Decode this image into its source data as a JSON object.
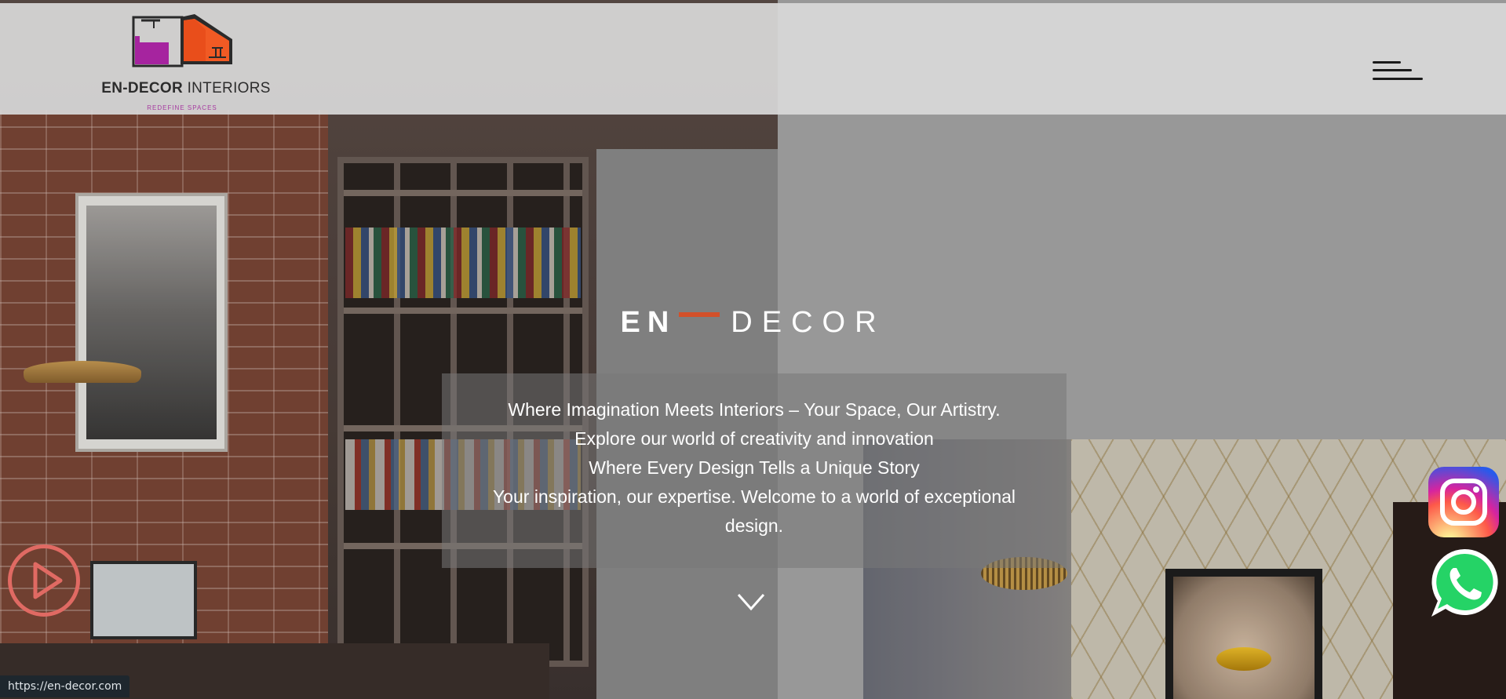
{
  "header": {
    "logo_name_bold": "EN-DECOR",
    "logo_name_rest": " INTERIORS",
    "logo_tagline": "REDEFINE SPACES",
    "menu_icon": "hamburger-menu-icon"
  },
  "hero": {
    "brand_en": "EN",
    "brand_decor": "DECOR",
    "tagline_lines": [
      "Where Imagination Meets Interiors – Your Space, Our Artistry.",
      "Explore our world of creativity and innovation",
      "Where Every Design Tells a Unique Story",
      "Your inspiration, our expertise. Welcome to a world of exceptional",
      "design."
    ],
    "scroll_icon": "chevron-down-icon"
  },
  "floating": {
    "play_icon": "play-icon",
    "instagram_icon": "instagram-icon",
    "whatsapp_icon": "whatsapp-icon"
  },
  "status_bar": {
    "url": "https://en-decor.com"
  },
  "colors": {
    "accent_orange": "#d2502a",
    "logo_magenta": "#a6249f",
    "logo_orange": "#f15a24",
    "play_red": "#e06a63",
    "whatsapp_green": "#25d366"
  }
}
